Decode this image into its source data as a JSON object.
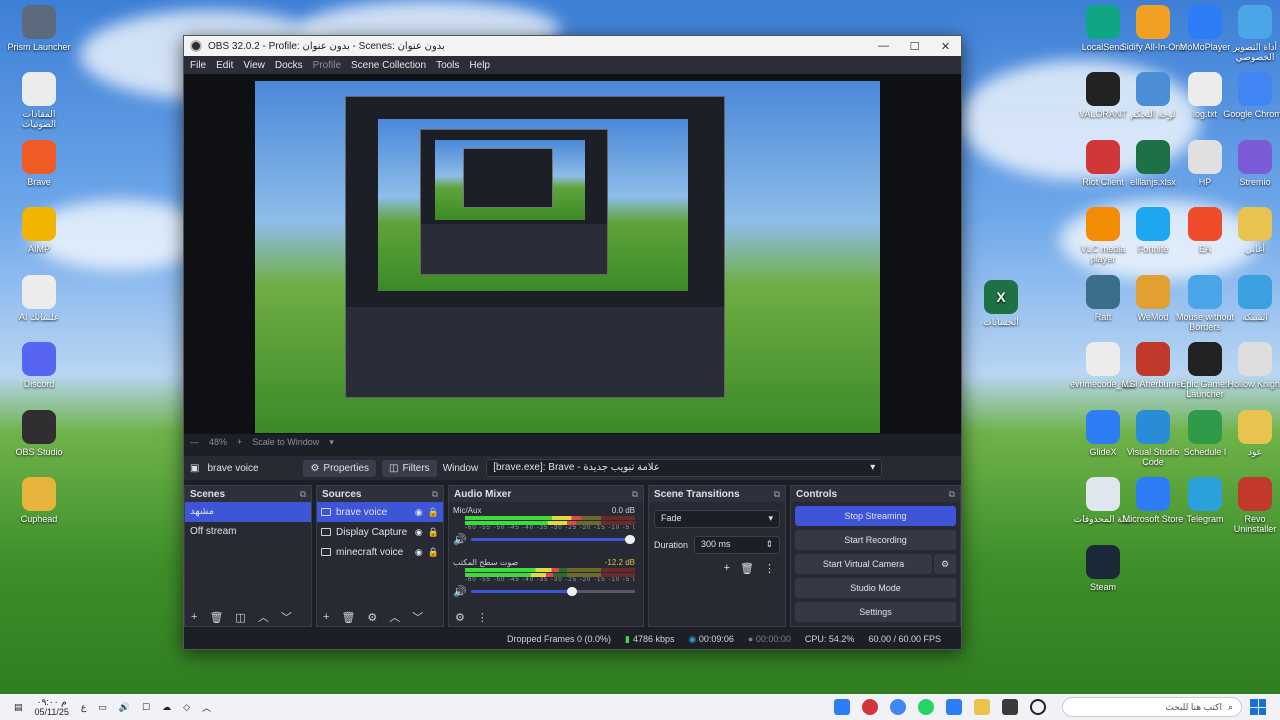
{
  "desktop": {
    "left_icons": [
      {
        "label": "Prism Launcher",
        "color": "#5b6b7d",
        "icon": "prism-launcher-icon"
      },
      {
        "label": "المقادات الصوتيات",
        "color": "#ececec",
        "icon": "document-icon"
      },
      {
        "label": "Brave",
        "color": "#f05a24",
        "icon": "brave-icon"
      },
      {
        "label": "AIMP",
        "color": "#f1b400",
        "icon": "aimp-icon"
      },
      {
        "label": "AI علشانك",
        "color": "#ececec",
        "icon": "document-icon"
      },
      {
        "label": "Discord",
        "color": "#5865f2",
        "icon": "discord-icon"
      },
      {
        "label": "OBS Studio",
        "color": "#302e31",
        "icon": "obs-icon"
      },
      {
        "label": "Cuphead",
        "color": "#e7b43b",
        "icon": "cuphead-icon"
      }
    ],
    "right_icons": [
      {
        "label": "LocalSend",
        "color": "#11a683",
        "icon": "localsend-icon"
      },
      {
        "label": "Sidify All-In-One",
        "color": "#f2a023",
        "icon": "sidify-icon"
      },
      {
        "label": "MoMoPlayer",
        "color": "#2f7df6",
        "icon": "momoplayer-icon"
      },
      {
        "label": "أداة التصوير الخصوصي",
        "color": "#4aa6e6",
        "icon": "file-icon"
      },
      {
        "label": "VALORANT",
        "color": "#222222",
        "icon": "valorant-icon"
      },
      {
        "label": "لوحة التحكم",
        "color": "#4b8ed6",
        "icon": "control-panel-icon"
      },
      {
        "label": "log.txt",
        "color": "#ececec",
        "icon": "text-file-icon"
      },
      {
        "label": "Google Chrome",
        "color": "#4285f4",
        "icon": "chrome-icon"
      },
      {
        "label": "Riot Client",
        "color": "#d13639",
        "icon": "riot-icon"
      },
      {
        "label": "elllanjs.xlsx",
        "color": "#1e7145",
        "icon": "excel-icon"
      },
      {
        "label": "HP",
        "color": "#e0e0e0",
        "icon": "file-icon"
      },
      {
        "label": "Stremio",
        "color": "#7b5bd6",
        "icon": "stremio-icon"
      },
      {
        "label": "VLC media player",
        "color": "#f48c06",
        "icon": "vlc-icon"
      },
      {
        "label": "Fortnite",
        "color": "#1ba8f0",
        "icon": "fortnite-icon"
      },
      {
        "label": "EA",
        "color": "#f04b2a",
        "icon": "ea-icon"
      },
      {
        "label": "أغاني",
        "color": "#e8c34f",
        "icon": "folder-icon"
      },
      {
        "label": "Raft",
        "color": "#3a6e8a",
        "icon": "raft-icon"
      },
      {
        "label": "WeMod",
        "color": "#e2a032",
        "icon": "wemod-icon"
      },
      {
        "label": "Mouse without Borders",
        "color": "#4aa6e6",
        "icon": "mouse-icon"
      },
      {
        "label": "الشبكة",
        "color": "#3aa0e0",
        "icon": "network-icon"
      },
      {
        "label": "evrimecode_لعبة",
        "color": "#ececec",
        "icon": "document-icon"
      },
      {
        "label": "MSI Afterburner",
        "color": "#c0392b",
        "icon": "msi-icon"
      },
      {
        "label": "Epic Games Launcher",
        "color": "#222222",
        "icon": "epic-icon"
      },
      {
        "label": "Hollow Knight",
        "color": "#dddddd",
        "icon": "hollow-knight-icon"
      },
      {
        "label": "GlideX",
        "color": "#2f7df6",
        "icon": "glidex-icon"
      },
      {
        "label": "Visual Studio Code",
        "color": "#2a8cd6",
        "icon": "vscode-icon"
      },
      {
        "label": "Schedule I",
        "color": "#2f9b4a",
        "icon": "schedule-icon"
      },
      {
        "label": "عود",
        "color": "#e8c34f",
        "icon": "folder-icon"
      },
      {
        "label": "سلة المحذوفات",
        "color": "#dfe6ee",
        "icon": "recycle-bin-icon"
      },
      {
        "label": "Microsoft Store",
        "color": "#2f7df6",
        "icon": "store-icon"
      },
      {
        "label": "Telegram",
        "color": "#2aa1da",
        "icon": "telegram-icon"
      },
      {
        "label": "Revo Uninstaller",
        "color": "#c0392b",
        "icon": "revo-icon"
      },
      {
        "label": "Steam",
        "color": "#1b2838",
        "icon": "steam-icon"
      }
    ],
    "mid_icon": {
      "label": "الحسابات",
      "color": "#1e7145",
      "icon": "excel-icon"
    }
  },
  "obs": {
    "title": "OBS 32.0.2 - Profile: بدون عنوان - Scenes: بدون عنوان",
    "menu": [
      "File",
      "Edit",
      "View",
      "Docks",
      "Profile",
      "Scene Collection",
      "Tools",
      "Help"
    ],
    "zoom": {
      "percent": "48%",
      "scale_mode": "Scale to Window"
    },
    "source_bar": {
      "source_name": "brave voice",
      "properties": "Properties",
      "filters": "Filters",
      "window_label": "Window",
      "window_value": "[brave.exe]: Brave - علامة تبويب جديدة"
    },
    "scenes": {
      "title": "Scenes",
      "items": [
        "مشهد",
        "Off stream"
      ],
      "active_index": 0
    },
    "sources": {
      "title": "Sources",
      "items": [
        "brave voice",
        "Display Capture",
        "minecraft voice"
      ],
      "active_index": 0
    },
    "mixer": {
      "title": "Audio Mixer",
      "channels": [
        {
          "name": "Mic/Aux",
          "db": "0.0 dB",
          "level": 0.68,
          "volume": 1.0
        },
        {
          "name": "صوت سطح المكتب",
          "db": "-12.2 dB",
          "level": 0.55,
          "volume": 0.65
        }
      ],
      "ticks": "-60 -55 -50 -45 -40 -35 -30 -25 -20 -15 -10 -5 0"
    },
    "transitions": {
      "title": "Scene Transitions",
      "selected": "Fade",
      "duration_label": "Duration",
      "duration_value": "300 ms"
    },
    "controls": {
      "title": "Controls",
      "stop_streaming": "Stop Streaming",
      "start_recording": "Start Recording",
      "start_virtual_camera": "Start Virtual Camera",
      "studio_mode": "Studio Mode",
      "settings": "Settings"
    },
    "status": {
      "dropped_frames": "Dropped Frames 0 (0.0%)",
      "bitrate": "4786 kbps",
      "stream_time": "00:09:06",
      "record_time": "00:00:00",
      "cpu": "CPU: 54.2%",
      "fps": "60.00 / 60.00 FPS"
    }
  },
  "taskbar": {
    "date_line1": "م ٠٩:٠٠",
    "date_line2": "05/11/25",
    "search_placeholder": "اكتب هنا للبحث"
  }
}
